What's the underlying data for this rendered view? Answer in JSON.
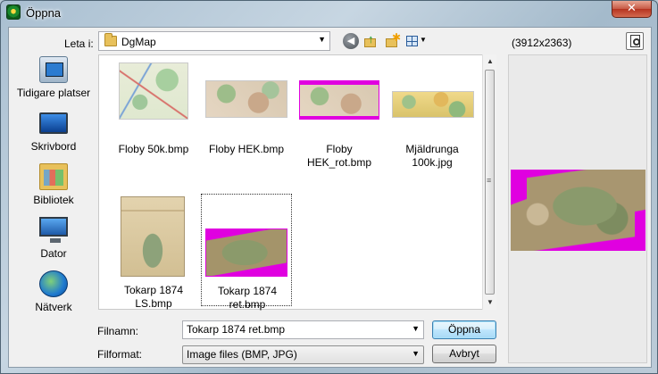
{
  "window": {
    "title": "Öppna",
    "close_label": "✕"
  },
  "toolbar": {
    "look_in_label": "Leta i:",
    "look_in_value": "DgMap"
  },
  "preview": {
    "size_text": "(3912x2363)"
  },
  "places": [
    {
      "label": "Tidigare platser",
      "icon": "recent-places-icon"
    },
    {
      "label": "Skrivbord",
      "icon": "desktop-icon"
    },
    {
      "label": "Bibliotek",
      "icon": "library-icon"
    },
    {
      "label": "Dator",
      "icon": "computer-icon"
    },
    {
      "label": "Nätverk",
      "icon": "network-icon"
    }
  ],
  "files": [
    {
      "name": "Floby 50k.bmp"
    },
    {
      "name": "Floby HEK.bmp"
    },
    {
      "name": "Floby HEK_rot.bmp"
    },
    {
      "name": "Mjäldrunga 100k.jpg"
    },
    {
      "name": "Tokarp 1874 LS.bmp"
    },
    {
      "name": "Tokarp 1874 ret.bmp",
      "selected": true
    }
  ],
  "form": {
    "filename_label": "Filnamn:",
    "filename_value": "Tokarp 1874 ret.bmp",
    "filetype_label": "Filformat:",
    "filetype_value": "Image files (BMP, JPG)",
    "open_label": "Öppna",
    "cancel_label": "Avbryt"
  },
  "colors": {
    "accent": "#3c7fb1",
    "magenta_fill": "#e000e0"
  }
}
